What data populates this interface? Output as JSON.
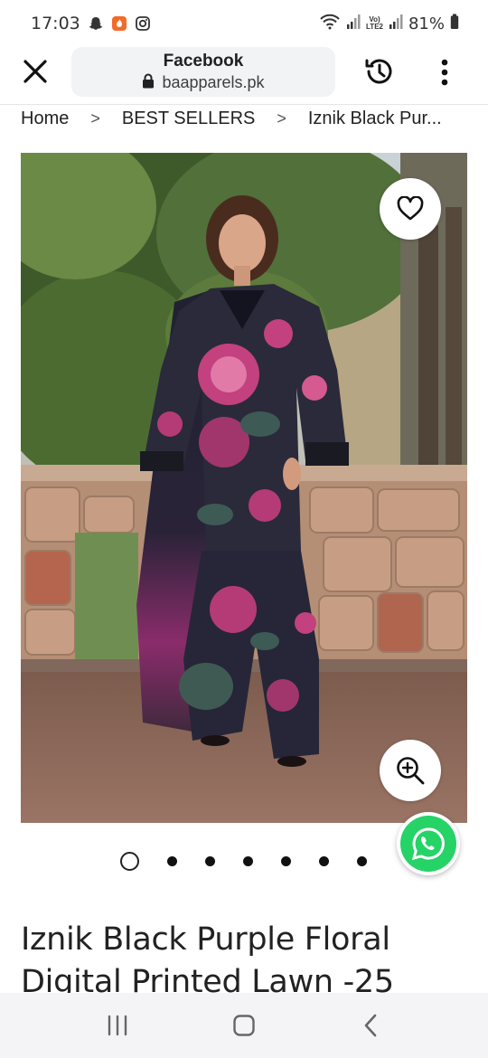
{
  "status_bar": {
    "time": "17:03",
    "network_top": "Vo)",
    "network_bottom": "LTE2",
    "battery": "81%",
    "icons": [
      "snapchat-icon",
      "app-notification-icon",
      "instagram-icon",
      "wifi-icon",
      "signal-icon",
      "battery-icon"
    ]
  },
  "browser": {
    "page_title": "Facebook",
    "domain": "baapparels.pk",
    "icons": [
      "close-icon",
      "lock-icon",
      "history-icon",
      "more-vert-icon"
    ]
  },
  "breadcrumb": {
    "items": [
      "Home",
      "BEST SELLERS",
      "Iznik Black Pur..."
    ],
    "separator": ">"
  },
  "gallery": {
    "total_images": 7,
    "active_index": 0,
    "icons": [
      "heart-icon",
      "zoom-in-icon",
      "whatsapp-icon"
    ]
  },
  "product": {
    "title": "Iznik Black Purple Floral Digital Printed Lawn -25"
  },
  "colors": {
    "accent_whatsapp": "#25d366",
    "url_bar_bg": "#f1f3f4",
    "nav_bar_bg": "#f4f4f6"
  }
}
